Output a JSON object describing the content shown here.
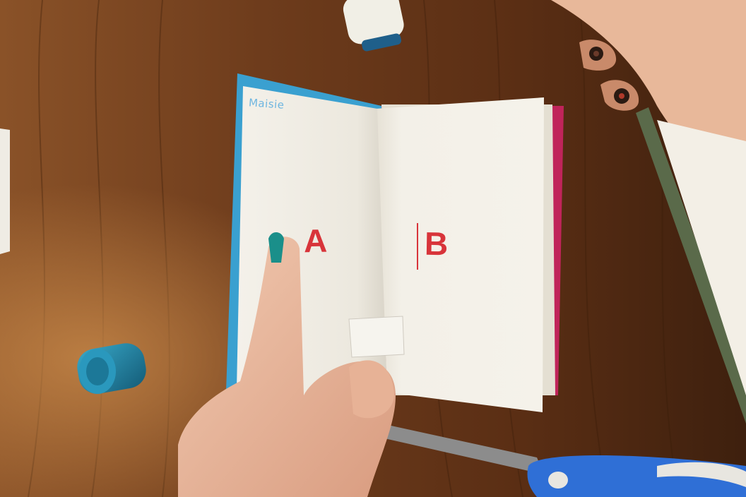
{
  "image": {
    "left_page_letter": "A",
    "right_page_letter": "B",
    "cover_handwriting": "Maisie"
  },
  "colors": {
    "table": "#7a4522",
    "book_cover": "#3aa0d0",
    "back_cover": "#c0245a",
    "stamp_ink": "#d8343a",
    "scissors_handle": "#2f6fd6",
    "glue_cap": "#1f7ea0"
  }
}
